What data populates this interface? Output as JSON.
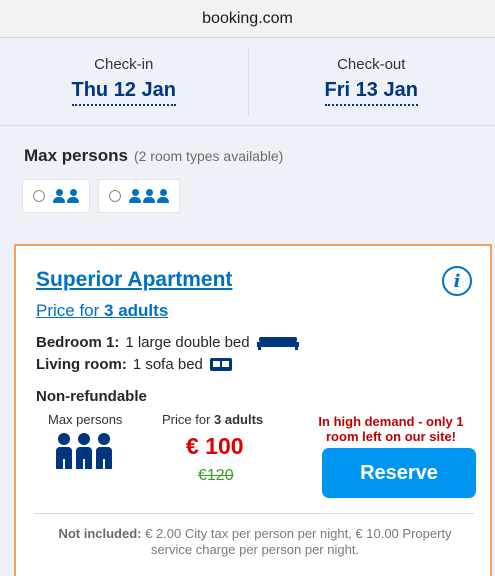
{
  "browser": {
    "url": "booking.com"
  },
  "dates": {
    "checkin_label": "Check-in",
    "checkin_value": "Thu 12 Jan",
    "checkout_label": "Check-out",
    "checkout_value": "Fri 13 Jan"
  },
  "max_persons": {
    "title": "Max persons",
    "subtitle": "(2 room types available)",
    "options": [
      {
        "persons": 2,
        "selected": false
      },
      {
        "persons": 3,
        "selected": false
      }
    ]
  },
  "room": {
    "title": "Superior Apartment",
    "price_for_prefix": "Price for ",
    "price_for_bold": "3 adults",
    "beds": [
      {
        "label": "Bedroom 1:",
        "value": "1 large double bed",
        "icon": "double-bed-icon"
      },
      {
        "label": "Living room:",
        "value": "1 sofa bed",
        "icon": "sofa-bed-icon"
      }
    ],
    "policy": "Non-refundable",
    "max_persons_label": "Max persons",
    "price_header_prefix": "Price for ",
    "price_header_bold": "3 adults",
    "price": "€ 100",
    "old_price": "€120",
    "demand_text": "In high demand - only 1 room left on our site!",
    "reserve_label": "Reserve",
    "not_included_label": "Not included:",
    "not_included_text": "€ 2.00 City tax per person per night, € 10.00 Property service charge per person per night."
  },
  "colors": {
    "brand_blue": "#003580",
    "link_blue": "#0071c2",
    "button_blue": "#0096f0",
    "price_red": "#e00000",
    "old_price_green": "#3a9a2a",
    "highlight_border": "#f6a15a"
  }
}
